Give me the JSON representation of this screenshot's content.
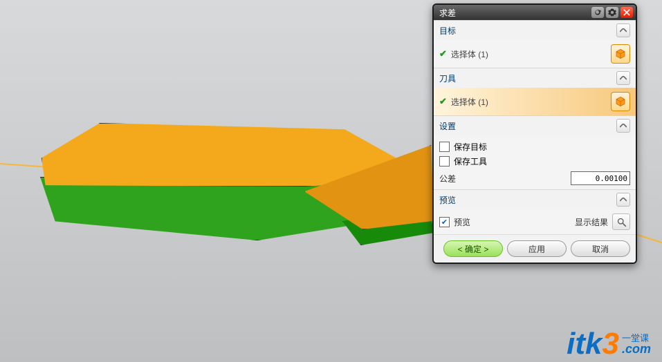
{
  "dialog": {
    "title": "求差",
    "sections": {
      "target": {
        "header": "目标",
        "select_label": "选择体 (1)"
      },
      "tool": {
        "header": "刀具",
        "select_label": "选择体 (1)"
      },
      "settings": {
        "header": "设置",
        "keep_target": "保存目标",
        "keep_tool": "保存工具",
        "tolerance_label": "公差",
        "tolerance_value": "0.00100"
      },
      "preview": {
        "header": "预览",
        "preview_label": "预览",
        "show_result": "显示结果"
      }
    },
    "buttons": {
      "ok": "< 确定 >",
      "apply": "应用",
      "cancel": "取消"
    }
  },
  "watermark": {
    "brand_a": "itk",
    "brand_b": "3",
    "tagline": "一堂课",
    "domain": ".com"
  }
}
